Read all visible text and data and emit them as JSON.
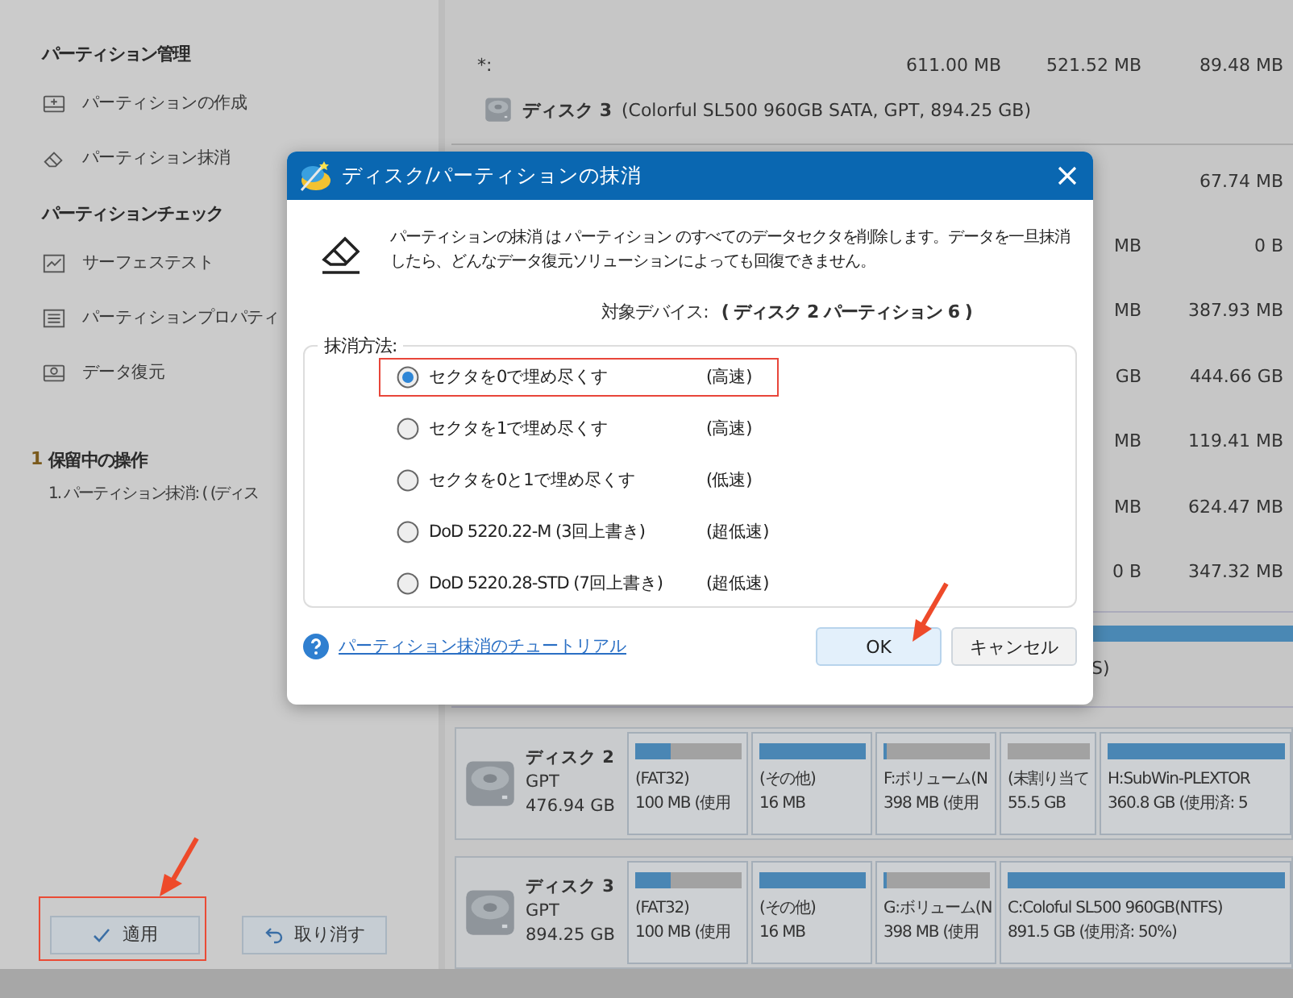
{
  "sidebar": {
    "sections": [
      {
        "title": "パーティション管理",
        "items": [
          {
            "kind": "create",
            "label": "パーティションの作成"
          },
          {
            "kind": "erase",
            "label": "パーティション抹消"
          }
        ]
      },
      {
        "title": "パーティションチェック",
        "items": [
          {
            "kind": "surface",
            "label": "サーフェステスト"
          },
          {
            "kind": "properties",
            "label": "パーティションプロパティ"
          },
          {
            "kind": "recovery",
            "label": "データ復元"
          }
        ]
      }
    ],
    "pending": {
      "count": "1",
      "title": "保留中の操作",
      "items": [
        "1. パーティション抹消: ( (ディス"
      ]
    },
    "buttons": [
      {
        "kind": "apply",
        "label": "適用"
      },
      {
        "kind": "undo",
        "label": "取り消す"
      }
    ]
  },
  "table": {
    "top_row": {
      "column_1": "*:",
      "column_2": "611.00 MB",
      "column_3": "521.52 MB",
      "column_4": "89.48 MB"
    },
    "disk_header": {
      "name": "ディスク 3",
      "detail": "(Colorful SL500 960GB SATA, GPT, 894.25 GB)"
    },
    "rows": [
      {
        "column_4": "67.74 MB"
      },
      {
        "column_3": "MB",
        "column_4": "0 B"
      },
      {
        "column_3": "MB",
        "column_4": "387.93 MB"
      },
      {
        "column_3": "GB",
        "column_4": "444.66 GB"
      },
      {
        "column_3": "MB",
        "column_4": "119.41 MB"
      },
      {
        "column_3": "MB",
        "column_4": "624.47 MB"
      },
      {
        "column_3": "0 B",
        "column_4": "347.32 MB"
      }
    ]
  },
  "disk_map": {
    "partial_label": "S)",
    "disks": [
      {
        "name": "ディスク 2",
        "style": "GPT",
        "size": "476.94 GB",
        "partitions": [
          {
            "label": "(FAT32)",
            "detail": "100 MB (使用",
            "level": 0.33
          },
          {
            "label": "(その他)",
            "detail": "16 MB",
            "level": 1
          },
          {
            "label": "F:ボリューム(N",
            "detail": "398 MB (使用",
            "level": 0.03
          },
          {
            "kind": "unallocated",
            "label": "(未割り当て",
            "detail": "55.5 GB"
          },
          {
            "label": "H:SubWin-PLEXTOR",
            "detail": "360.8 GB (使用済: 5",
            "level": 1
          }
        ]
      },
      {
        "name": "ディスク 3",
        "style": "GPT",
        "size": "894.25 GB",
        "partitions": [
          {
            "label": "(FAT32)",
            "detail": "100 MB (使用",
            "level": 0.33
          },
          {
            "label": "(その他)",
            "detail": "16 MB",
            "level": 1
          },
          {
            "label": "G:ボリューム(N",
            "detail": "398 MB (使用",
            "level": 0.03
          },
          {
            "label": "C:Coloful SL500 960GB(NTFS)",
            "detail": "891.5 GB (使用済: 50%)",
            "level": 1
          }
        ]
      }
    ]
  },
  "dialog": {
    "title": "ディスク/パーティションの抹消",
    "description": "パーティションの抹消 は パーティション のすべてのデータセクタを削除します。データを一旦抹消したら、どんなデータ復元ソリューションによっても回復できません。",
    "target_label": "対象デバイス:",
    "target_value": "( ディスク 2 パーティション 6 )",
    "group_title": "抹消方法:",
    "options": [
      {
        "label": "セクタを0で埋め尽くす",
        "speed": "(高速)",
        "selected": true
      },
      {
        "label": "セクタを1で埋め尽くす",
        "speed": "(高速)",
        "selected": false
      },
      {
        "label": "セクタを0と1で埋め尽くす",
        "speed": "(低速)",
        "selected": false
      },
      {
        "label": "DoD 5220.22-M (3回上書き)",
        "speed": "(超低速)",
        "selected": false
      },
      {
        "label": "DoD 5220.28-STD (7回上書き)",
        "speed": "(超低速)",
        "selected": false
      }
    ],
    "help_link": "パーティション抹消のチュートリアル",
    "buttons": [
      {
        "label": "OK",
        "default": true
      },
      {
        "label": "キャンセル",
        "default": false
      }
    ]
  }
}
